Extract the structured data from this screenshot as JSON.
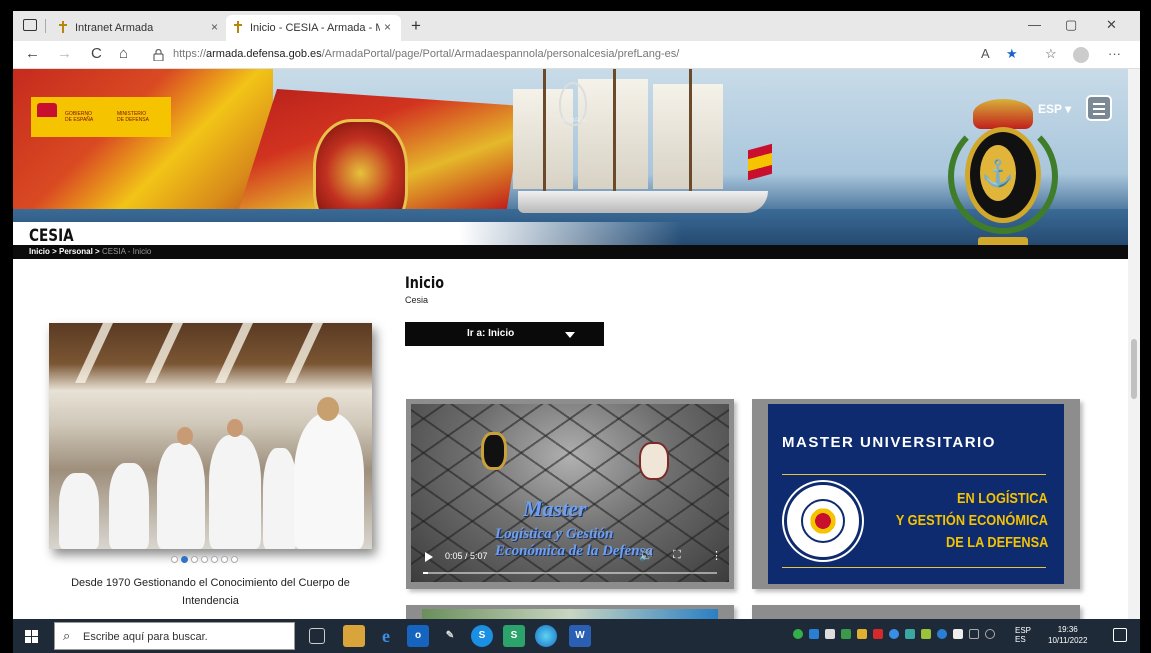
{
  "browser": {
    "tabs": [
      {
        "label": "Intranet Armada",
        "active": false
      },
      {
        "label": "Inicio - CESIA - Armada - Ministe",
        "active": true
      }
    ],
    "url_prefix": "https://",
    "url_domain": "armada.defensa.gob.es",
    "url_path": "/ArmadaPortal/page/Portal/Armadaespannola/personalcesia/prefLang-es/",
    "new_tab": "+",
    "close": "×",
    "minimize": "—",
    "maximize": "▢",
    "close_window": "✕",
    "back": "←",
    "forward": "→",
    "reload": "C",
    "home": "⌂",
    "reader": "A",
    "more": "···"
  },
  "header": {
    "gov_line1": "GOBIERNO",
    "gov_line2": "DE ESPAÑA",
    "min_line1": "MINISTERIO",
    "min_line2": "DE DEFENSA",
    "armada_logo_text": "ARMADA",
    "language": "ESP ▾",
    "site_title": "CESIA",
    "breadcrumb": [
      {
        "label": "Inicio",
        "current": false
      },
      {
        "label": "Personal",
        "current": false
      },
      {
        "label": "CESIA - Inicio",
        "current": true
      }
    ],
    "breadcrumb_sep": " > "
  },
  "main": {
    "page_title": "Inicio",
    "page_subtitle": "Cesia",
    "goto_label": "Ir a: Inicio",
    "carousel": {
      "caption": "Desde 1970 Gestionando el Conocimiento del Cuerpo de Intendencia",
      "slide_count": 7,
      "active_slide": 2
    },
    "video": {
      "title_line1": "Master",
      "title_line2": "Logística y Gestión",
      "title_line3": "Económica de la Defensa",
      "time": "0:05 / 5:07",
      "progress": 0.016
    },
    "master_card": {
      "title": "MASTER UNIVERSITARIO",
      "line1": "EN LOGÍSTICA",
      "line2": "Y GESTIÓN ECONÓMICA",
      "line3": "DE LA DEFENSA"
    }
  },
  "taskbar": {
    "search_placeholder": "Escribe aquí para buscar.",
    "lang_top": "ESP",
    "lang_bottom": "ES",
    "time": "19:36",
    "date": "10/11/2022"
  },
  "colors": {
    "accent_blue": "#0d2b6e",
    "gold": "#f5c300",
    "dark": "#0a0a0a"
  }
}
